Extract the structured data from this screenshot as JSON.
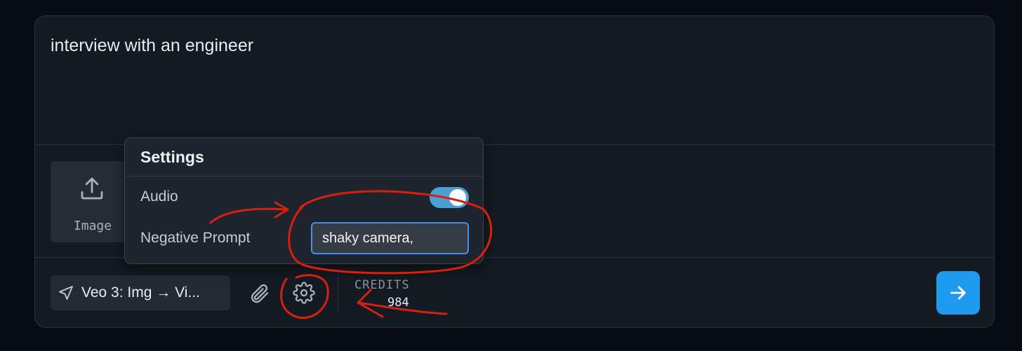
{
  "prompt": {
    "text": "interview with an engineer"
  },
  "upload": {
    "label": "Image",
    "icon": "upload-icon"
  },
  "toolbar": {
    "model_label": "Veo 3: Img → Vi...",
    "model_icon": "navigation-arrow-icon",
    "attach_icon": "paperclip-icon",
    "settings_icon": "gear-icon",
    "credits_label": "CREDITS",
    "credits_value": "984",
    "send_icon": "arrow-right-icon"
  },
  "settings": {
    "title": "Settings",
    "audio_label": "Audio",
    "audio_enabled": true,
    "negative_prompt_label": "Negative Prompt",
    "negative_prompt_value": "shaky camera,"
  },
  "colors": {
    "background": "#070b12",
    "panel": "#141a22",
    "accent": "#1e9bef",
    "toggle_on": "#4ba0d6",
    "annotation": "#d8200f"
  }
}
